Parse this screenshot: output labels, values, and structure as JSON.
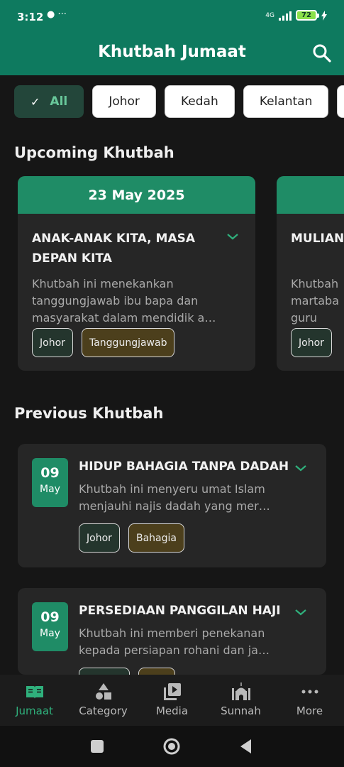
{
  "status": {
    "time": "3:12",
    "icons_text": "● ···",
    "network": "4G",
    "battery": "72"
  },
  "header": {
    "title": "Khutbah Jumaat"
  },
  "filters": [
    {
      "label": "All",
      "active": true
    },
    {
      "label": "Johor"
    },
    {
      "label": "Kedah"
    },
    {
      "label": "Kelantan"
    },
    {
      "label": "K"
    }
  ],
  "sections": {
    "upcoming": "Upcoming Khutbah",
    "previous": "Previous Khutbah"
  },
  "upcoming": [
    {
      "date": "23 May 2025",
      "title": "ANAK-ANAK KITA, MASA DEPAN KITA",
      "desc": "Khutbah ini menekankan tanggungjawab ibu bapa dan masyarakat dalam mendidik a…",
      "tags": [
        "Johor",
        "Tanggungjawab"
      ]
    },
    {
      "date": "",
      "title": "MULIAN KEMULIA",
      "desc": "Khutbah martaba guru seb",
      "tags": [
        "Johor"
      ]
    }
  ],
  "previous": [
    {
      "day": "09",
      "month": "May",
      "title": "HIDUP BAHAGIA TANPA DADAH",
      "desc": "Khutbah ini menyeru umat Islam menjauhi najis dadah yang mer…",
      "tags": [
        "Johor",
        "Bahagia"
      ]
    },
    {
      "day": "09",
      "month": "May",
      "title": "PERSEDIAAN PANGGILAN HAJI",
      "desc": "Khutbah ini memberi penekanan kepada persiapan rohani dan ja…",
      "tags": [
        "",
        ""
      ]
    }
  ],
  "nav": [
    {
      "label": "Jumaat",
      "icon": "book-icon",
      "active": true
    },
    {
      "label": "Category",
      "icon": "shapes-icon"
    },
    {
      "label": "Media",
      "icon": "media-icon"
    },
    {
      "label": "Sunnah",
      "icon": "mosque-icon"
    },
    {
      "label": "More",
      "icon": "more-icon"
    }
  ],
  "colors": {
    "primary": "#0e7a5f",
    "accent": "#1f8c66",
    "active_nav": "#2fb07c",
    "background": "#161616",
    "card": "#262626"
  }
}
